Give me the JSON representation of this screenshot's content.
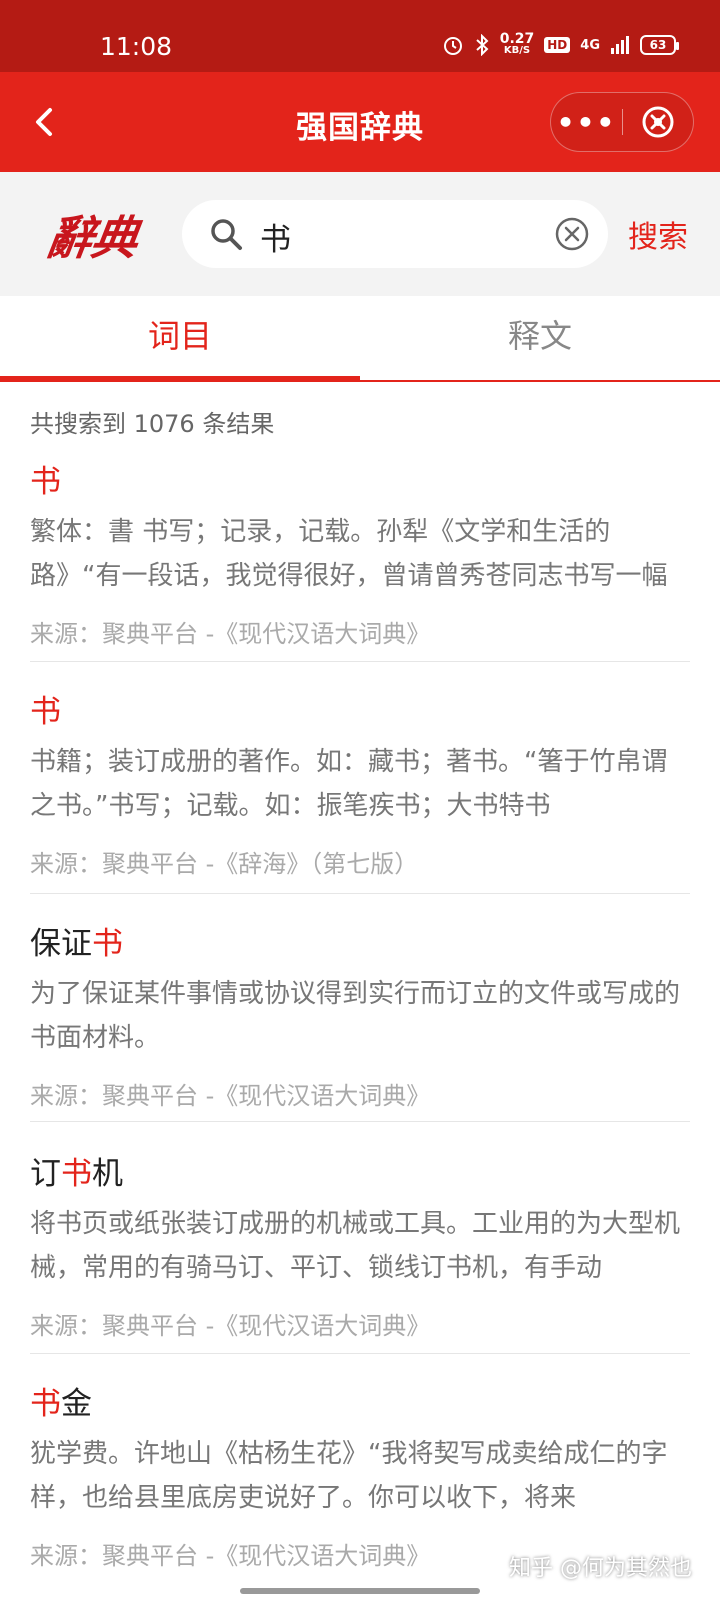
{
  "status_bar": {
    "time": "11:08",
    "speed": "0.27",
    "speed_unit": "KB/S",
    "hd": "HD",
    "network": "4G",
    "battery": "63"
  },
  "title_bar": {
    "title": "强国辞典",
    "more": "•••"
  },
  "search": {
    "logo_text": "辭典",
    "query": "书",
    "button": "搜索"
  },
  "tabs": [
    {
      "label": "词目"
    },
    {
      "label": "释文"
    }
  ],
  "results": {
    "count_text": "共搜索到 1076 条结果",
    "items": [
      {
        "pre": "",
        "hl": "书",
        "post": "",
        "desc": "繁体：書 书写；记录，记载。孙犁《文学和生活的路》“有一段话，我觉得很好，曾请曾秀苍同志书写一幅",
        "source": "来源：聚典平台 -《现代汉语大词典》"
      },
      {
        "pre": "",
        "hl": "书",
        "post": "",
        "desc": "书籍；装订成册的著作。如：藏书；著书。“箸于竹帛谓之书。”书写；记载。如：振笔疾书；大书特书",
        "source": "来源：聚典平台 -《辞海》（第七版）"
      },
      {
        "pre": "保证",
        "hl": "书",
        "post": "",
        "desc": "为了保证某件事情或协议得到实行而订立的文件或写成的书面材料。",
        "source": "来源：聚典平台 -《现代汉语大词典》"
      },
      {
        "pre": "订",
        "hl": "书",
        "post": "机",
        "desc": "将书页或纸张装订成册的机械或工具。工业用的为大型机械，常用的有骑马订、平订、锁线订书机，有手动",
        "source": "来源：聚典平台 -《现代汉语大词典》"
      },
      {
        "pre": "",
        "hl": "书",
        "post": "金",
        "desc": "犹学费。许地山《枯杨生花》“我将契写成卖给成仁的字样，也给县里底房吏说好了。你可以收下，将来",
        "source": "来源：聚典平台 -《现代汉语大词典》"
      }
    ]
  },
  "watermark": "知乎 @何为其然也",
  "colors": {
    "accent": "#e3241b",
    "status_bar": "#b41b14",
    "search_bg": "#f3f3f3"
  }
}
